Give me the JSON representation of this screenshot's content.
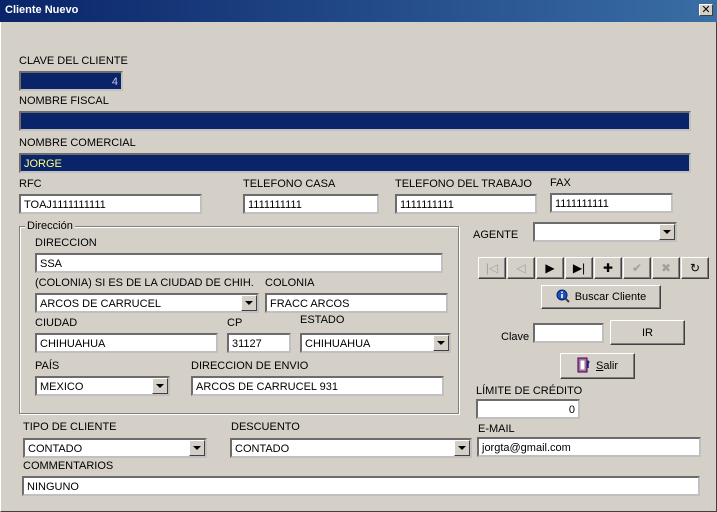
{
  "window": {
    "title": "Cliente Nuevo",
    "close_glyph": "✕"
  },
  "labels": {
    "clave_cliente": "CLAVE DEL CLIENTE",
    "nombre_fiscal": "NOMBRE FISCAL",
    "nombre_comercial": "NOMBRE COMERCIAL",
    "rfc": "RFC",
    "tel_casa": "TELEFONO CASA",
    "tel_trabajo": "TELEFONO DEL TRABAJO",
    "fax": "FAX",
    "direccion_group": "Dirección",
    "direccion": "DIRECCION",
    "colonia_chih": "(COLONIA) SI ES DE LA CIUDAD DE CHIH.",
    "colonia": "COLONIA",
    "ciudad": "CIUDAD",
    "cp": "CP",
    "estado": "ESTADO",
    "pais": "PAÍS",
    "direccion_envio": "DIRECCION DE ENVIO",
    "agente": "AGENTE",
    "clave": "Clave",
    "limite_credito": "LÍMITE DE CRÉDITO",
    "tipo_cliente": "TIPO DE CLIENTE",
    "descuento": "DESCUENTO",
    "email": "E-MAIL",
    "comentarios": "COMMENTARIOS"
  },
  "values": {
    "clave_cliente": "4",
    "nombre_fiscal": "",
    "nombre_comercial": "JORGE",
    "rfc": "TOAJ1111111111",
    "tel_casa": "1111111111",
    "tel_trabajo": "1111111111",
    "fax": "1111111111",
    "direccion": "SSA",
    "colonia_chih": "ARCOS DE CARRUCEL",
    "colonia": "FRACC ARCOS",
    "ciudad": "CHIHUAHUA",
    "cp": "31127",
    "estado": "CHIHUAHUA",
    "pais": "MEXICO",
    "direccion_envio": "ARCOS DE CARRUCEL 931",
    "agente": "",
    "clave": "",
    "limite_credito": "0",
    "tipo_cliente": "CONTADO",
    "descuento": "CONTADO",
    "email": "jorgta@gmail.com",
    "comentarios": "NINGUNO"
  },
  "buttons": {
    "buscar_cliente": "Buscar Cliente",
    "ir": "IR",
    "salir": "Salir"
  },
  "nav_glyphs": {
    "first": "|◁",
    "prev": "◁",
    "next": "▶",
    "last": "▶|",
    "add": "✚",
    "confirm": "✔",
    "cancel": "✖",
    "refresh": "↻"
  }
}
